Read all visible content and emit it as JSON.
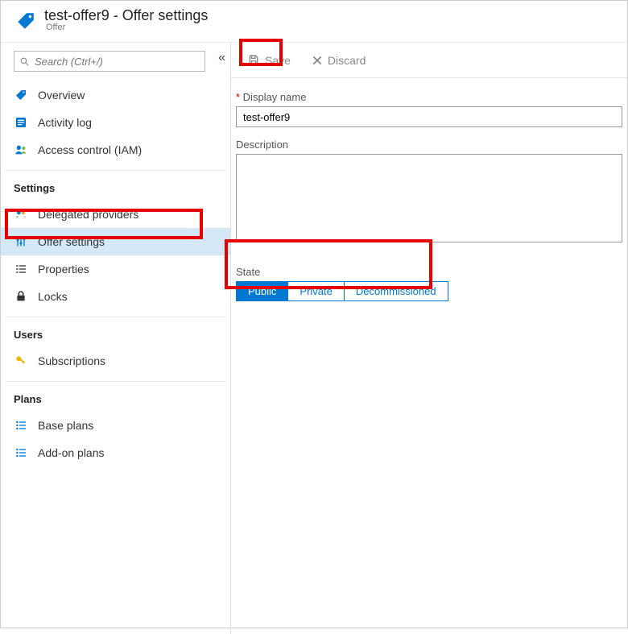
{
  "header": {
    "title": "test-offer9 - Offer settings",
    "subtitle": "Offer"
  },
  "search": {
    "placeholder": "Search (Ctrl+/)"
  },
  "sidebar": {
    "top": [
      {
        "label": "Overview"
      },
      {
        "label": "Activity log"
      },
      {
        "label": "Access control (IAM)"
      }
    ],
    "settings_label": "Settings",
    "settings": [
      {
        "label": "Delegated providers"
      },
      {
        "label": "Offer settings"
      },
      {
        "label": "Properties"
      },
      {
        "label": "Locks"
      }
    ],
    "users_label": "Users",
    "users": [
      {
        "label": "Subscriptions"
      }
    ],
    "plans_label": "Plans",
    "plans": [
      {
        "label": "Base plans"
      },
      {
        "label": "Add-on plans"
      }
    ]
  },
  "toolbar": {
    "save_label": "Save",
    "discard_label": "Discard"
  },
  "form": {
    "displayname_label": "Display name",
    "displayname_value": "test-offer9",
    "description_label": "Description",
    "description_value": "",
    "state_label": "State",
    "state_options": [
      "Public",
      "Private",
      "Decommissioned"
    ],
    "state_selected": "Public"
  },
  "colors": {
    "accent": "#0078d4",
    "highlight_red": "#e60000"
  }
}
